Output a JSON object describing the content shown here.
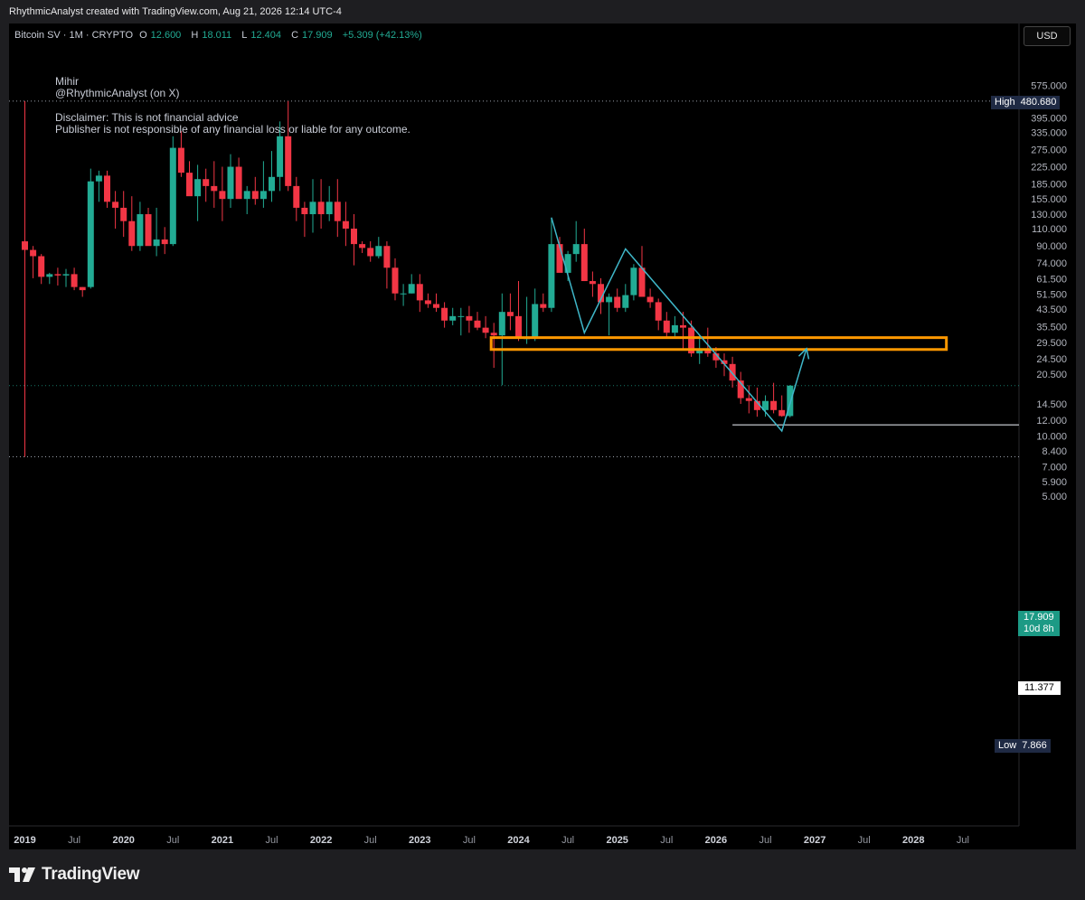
{
  "header": {
    "credit": "RhythmicAnalyst created with TradingView.com, Aug 21, 2026 12:14 UTC-4"
  },
  "symbol": {
    "title": "Bitcoin SV · 1M · CRYPTO",
    "open_label": "O",
    "open": "12.600",
    "high_label": "H",
    "high": "18.011",
    "low_label": "L",
    "low": "12.404",
    "close_label": "C",
    "close": "17.909",
    "change": "+5.309 (+42.13%)"
  },
  "notes": {
    "author": "Mihir",
    "handle": "@RhythmicAnalyst (on X)",
    "disclaimer_1": "Disclaimer: This is not financial advice",
    "disclaimer_2": "Publisher is not responsible of any financial loss or liable for any outcome."
  },
  "currency": "USD",
  "markers": {
    "high_label": "High",
    "high_value": "480.680",
    "low_label": "Low",
    "low_value": "7.866",
    "last_price": "17.909",
    "countdown": "10d 8h",
    "level": "11.377"
  },
  "footer": {
    "brand": "TradingView",
    "logo_icon": "tradingview-logo-icon"
  },
  "colors": {
    "up": "#22ab94",
    "down": "#f23645",
    "pattern": "#3fb7c9",
    "zone": "#ff9800",
    "background": "#000000"
  },
  "chart_data": {
    "type": "candlestick",
    "scale": "log",
    "ylim": [
      4.7,
      680
    ],
    "yticks": [
      575,
      395,
      335,
      275,
      225,
      185,
      155,
      130,
      110,
      90,
      74,
      61.5,
      51.5,
      43.5,
      35.5,
      29.5,
      24.5,
      20.5,
      14.5,
      12,
      10,
      8.4,
      7,
      5.9,
      5
    ],
    "ytick_labels": [
      "575.000",
      "395.000",
      "335.000",
      "275.000",
      "225.000",
      "185.000",
      "155.000",
      "130.000",
      "110.000",
      "90.000",
      "74.000",
      "61.500",
      "51.500",
      "43.500",
      "35.500",
      "29.500",
      "24.500",
      "20.500",
      "14.500",
      "12.000",
      "10.000",
      "8.400",
      "7.000",
      "5.900",
      "5.000"
    ],
    "x_labels": [
      "2019",
      "Jul",
      "2020",
      "Jul",
      "2021",
      "Jul",
      "2022",
      "Jul",
      "2023",
      "Jul",
      "2024",
      "Jul",
      "2025",
      "Jul",
      "2026",
      "Jul",
      "2027",
      "Jul",
      "2028",
      "Jul"
    ],
    "x_label_months": [
      0,
      6,
      12,
      18,
      24,
      30,
      36,
      42,
      48,
      54,
      60,
      66,
      72,
      78,
      84,
      90,
      96,
      102,
      108,
      114
    ],
    "first_month": "2018-11",
    "candles": [
      [
        95,
        480.68,
        7.87,
        86
      ],
      [
        86,
        90,
        62,
        80
      ],
      [
        80,
        82,
        58,
        63
      ],
      [
        63,
        66,
        58,
        65
      ],
      [
        65,
        70,
        57,
        64
      ],
      [
        64,
        69,
        56,
        65
      ],
      [
        65,
        70,
        54,
        56
      ],
      [
        56,
        56,
        50,
        54
      ],
      [
        56,
        220,
        55,
        190
      ],
      [
        190,
        215,
        150,
        203
      ],
      [
        203,
        215,
        140,
        150
      ],
      [
        150,
        170,
        110,
        140
      ],
      [
        140,
        170,
        100,
        120
      ],
      [
        120,
        160,
        85,
        90
      ],
      [
        90,
        150,
        85,
        130
      ],
      [
        130,
        140,
        95,
        90
      ],
      [
        90,
        140,
        80,
        97
      ],
      [
        97,
        112,
        82,
        92
      ],
      [
        92,
        320,
        90,
        280
      ],
      [
        280,
        340,
        200,
        210
      ],
      [
        210,
        240,
        170,
        160
      ],
      [
        160,
        230,
        120,
        195
      ],
      [
        195,
        220,
        150,
        180
      ],
      [
        180,
        240,
        140,
        170
      ],
      [
        170,
        225,
        120,
        155
      ],
      [
        155,
        260,
        140,
        225
      ],
      [
        225,
        250,
        170,
        155
      ],
      [
        155,
        180,
        130,
        170
      ],
      [
        170,
        200,
        145,
        155
      ],
      [
        155,
        240,
        140,
        170
      ],
      [
        170,
        270,
        150,
        200
      ],
      [
        200,
        380,
        170,
        320
      ],
      [
        320,
        480.68,
        170,
        180
      ],
      [
        180,
        200,
        120,
        140
      ],
      [
        140,
        150,
        100,
        130
      ],
      [
        130,
        195,
        105,
        150
      ],
      [
        150,
        195,
        110,
        130
      ],
      [
        130,
        180,
        120,
        150
      ],
      [
        150,
        195,
        100,
        120
      ],
      [
        120,
        150,
        90,
        110
      ],
      [
        110,
        130,
        72,
        92
      ],
      [
        92,
        95,
        83,
        88
      ],
      [
        88,
        95,
        75,
        80
      ],
      [
        80,
        100,
        78,
        90
      ],
      [
        90,
        95,
        55,
        70
      ],
      [
        70,
        78,
        48,
        52
      ],
      [
        52,
        58,
        45,
        52
      ],
      [
        52,
        65,
        52,
        58
      ],
      [
        58,
        65,
        42,
        48
      ],
      [
        48,
        52,
        44,
        46
      ],
      [
        46,
        52,
        42,
        44
      ],
      [
        44,
        47,
        35,
        38
      ],
      [
        38,
        44,
        36,
        40
      ],
      [
        40,
        44,
        32,
        40
      ],
      [
        40,
        45,
        33,
        38
      ],
      [
        38,
        42,
        34,
        35
      ],
      [
        35,
        40,
        31,
        33
      ],
      [
        33,
        37,
        22,
        32
      ],
      [
        32,
        52,
        18,
        42
      ],
      [
        42,
        52,
        34,
        40
      ],
      [
        40,
        60,
        30,
        31
      ],
      [
        31,
        50,
        29,
        31
      ],
      [
        31,
        55,
        30,
        46
      ],
      [
        46,
        52,
        42,
        44
      ],
      [
        44,
        125,
        42,
        92
      ],
      [
        92,
        100,
        72,
        66
      ],
      [
        66,
        85,
        60,
        82
      ],
      [
        82,
        120,
        75,
        92
      ],
      [
        92,
        110,
        60,
        60
      ],
      [
        60,
        67,
        50,
        58
      ],
      [
        58,
        62,
        41,
        47
      ],
      [
        47,
        52,
        32,
        50
      ],
      [
        50,
        55,
        42,
        44
      ],
      [
        44,
        58,
        42,
        51
      ],
      [
        51,
        73,
        48,
        70
      ],
      [
        70,
        90,
        57,
        50
      ],
      [
        50,
        55,
        44,
        47
      ],
      [
        47,
        49,
        34,
        38
      ],
      [
        38,
        42,
        31,
        33
      ],
      [
        33,
        40,
        31,
        36
      ],
      [
        36,
        42,
        27,
        35
      ],
      [
        35,
        38,
        25,
        26
      ],
      [
        26,
        32,
        23,
        27
      ],
      [
        27,
        35,
        25,
        26
      ],
      [
        26,
        28,
        22,
        24
      ],
      [
        24,
        26,
        20,
        23
      ],
      [
        23,
        25,
        17.5,
        19
      ],
      [
        19,
        21,
        14.5,
        15.5
      ],
      [
        15.5,
        18,
        13,
        15
      ],
      [
        15,
        17.5,
        12.5,
        13.5
      ],
      [
        13.5,
        16,
        12.5,
        15
      ],
      [
        15,
        18.5,
        13,
        13.5
      ],
      [
        13.5,
        16,
        12.5,
        12.6
      ],
      [
        12.6,
        18.011,
        12.404,
        17.909
      ]
    ],
    "annotations": {
      "resistance_zone": {
        "from": "2023-08",
        "to": "2028-03",
        "low": 27.2,
        "high": 31.2,
        "color": "#ff9800"
      },
      "pattern_path": [
        [
          "2024-03",
          125
        ],
        [
          "2024-07",
          33
        ],
        [
          "2024-12",
          87
        ],
        [
          "2026-07",
          10.6
        ],
        [
          "2026-10",
          27.5
        ]
      ],
      "horizontal_level": {
        "from": "2026-01",
        "value": 11.377
      },
      "high_line": 480.68,
      "low_line": 7.866,
      "last_line": 17.909
    }
  }
}
